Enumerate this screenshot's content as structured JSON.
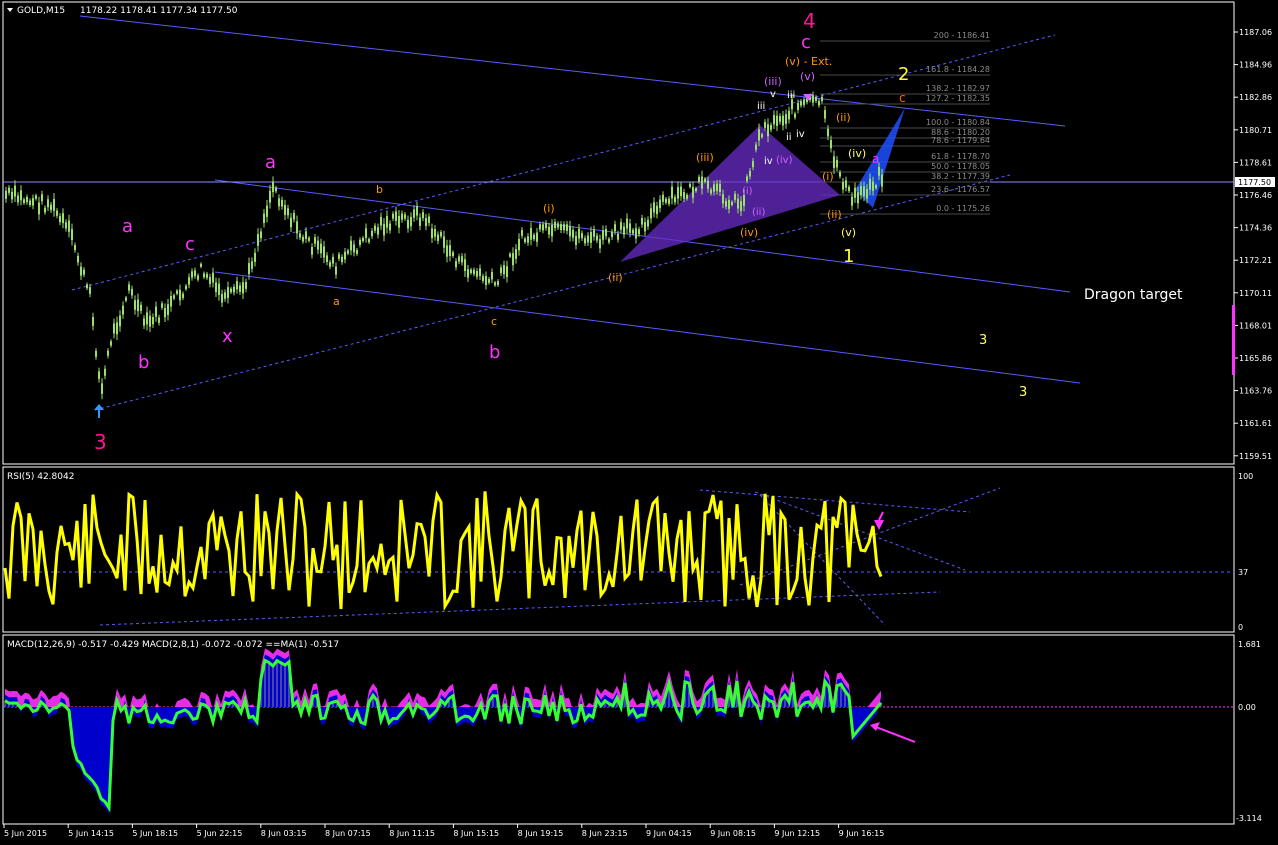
{
  "header": {
    "symbol_label": "GOLD,M15",
    "ohlc": "1178.22 1178.41 1177.34 1177.50"
  },
  "colors": {
    "background": "#000000",
    "candle": "#9ce06a",
    "channel": "#5a5aff",
    "rsi": "#ffff00",
    "macd_line": "#00ff00",
    "macd_fill": "#0000cc",
    "signal_fill": "#ff00ff",
    "wave_primary": "#ff1493",
    "wave_magenta": "#ff33ff",
    "wave_orange": "#ff9900",
    "wave_yellow": "#ffff66"
  },
  "main_chart": {
    "price_axis": [
      "1187.06",
      "1184.96",
      "1182.86",
      "1180.71",
      "1178.61",
      "1176.46",
      "1174.36",
      "1172.21",
      "1170.11",
      "1168.01",
      "1165.86",
      "1163.76",
      "1161.61",
      "1159.51"
    ],
    "current_price": "1177.50",
    "labels": {
      "wave4": "4",
      "wave_c_top": "c",
      "ext": "(v) - Ext.",
      "wave2": "2",
      "wave3_low": "3",
      "wave_a1": "a",
      "wave_b1": "b",
      "wave_c1": "c",
      "wave_x": "x",
      "wave_a2": "a",
      "wave_b2": "b",
      "small_a": "a",
      "small_b": "b",
      "small_c": "c",
      "i1": "(i)",
      "ii1": "(ii)",
      "iii1": "(iii)",
      "iv1": "(iv)",
      "v1": "(v)",
      "wave1": "1",
      "iii_top": "(iii)",
      "iii_small": "iii",
      "v_small": "v",
      "iv_small": "iv",
      "i_small": "(i)",
      "ii_small": "(ii)",
      "iv_purple": "(iv)",
      "iii_r": "iii",
      "iv_r": "iv",
      "ii_r": "ii",
      "ii2": "(ii)",
      "iv2": "(iv)",
      "i2": "(i)",
      "ii3": "(ii)",
      "a_blue": "a",
      "c_orange": "c",
      "v_top": "(v)",
      "dragon": "Dragon target",
      "three_a": "3",
      "three_b": "3"
    },
    "fib_levels": [
      "200 - 1186.41",
      "161.8 - 1184.28",
      "138.2 - 1182.97",
      "127.2 - 1182.35",
      "100.0 - 1180.84",
      "88.6 - 1180.20",
      "78.6 - 1179.64",
      "61.8 - 1178.70",
      "50.0 - 1178.05",
      "38.2 - 1177.39",
      "23.6 - 1176.57",
      "0.0 - 1175.26"
    ]
  },
  "rsi_panel": {
    "title": "RSI(5) 42.8042",
    "axis": [
      "100",
      "37",
      "0"
    ]
  },
  "macd_panel": {
    "title": "MACD(12,26,9) -0.517 -0.429  MACD(2,8,1) -0.072 -0.072  ==MA(1) -0.517",
    "axis": [
      "1.681",
      "0.00",
      "-3.114"
    ]
  },
  "time_axis": [
    "5 Jun 2015",
    "5 Jun 14:15",
    "5 Jun 18:15",
    "5 Jun 22:15",
    "8 Jun 03:15",
    "8 Jun 07:15",
    "8 Jun 11:15",
    "8 Jun 15:15",
    "8 Jun 19:15",
    "8 Jun 23:15",
    "9 Jun 04:15",
    "9 Jun 08:15",
    "9 Jun 12:15",
    "9 Jun 16:15"
  ]
}
